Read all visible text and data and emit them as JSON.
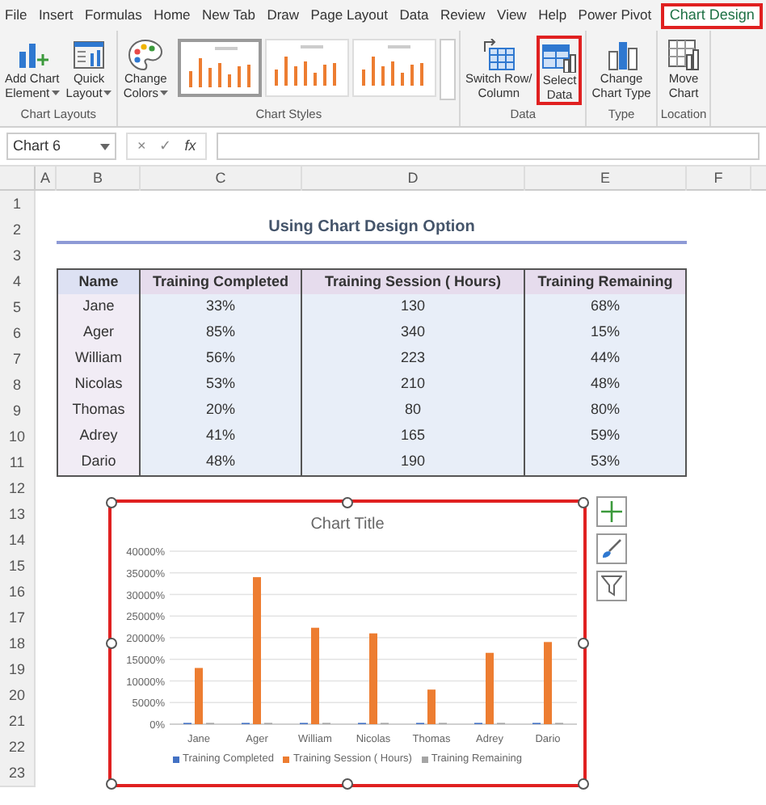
{
  "ribbon": {
    "tabs": [
      {
        "label": "File",
        "selected": false
      },
      {
        "label": "Insert",
        "selected": false
      },
      {
        "label": "Formulas",
        "selected": false
      },
      {
        "label": "Home",
        "selected": false
      },
      {
        "label": "New Tab",
        "selected": false
      },
      {
        "label": "Draw",
        "selected": false
      },
      {
        "label": "Page Layout",
        "selected": false
      },
      {
        "label": "Data",
        "selected": false
      },
      {
        "label": "Review",
        "selected": false
      },
      {
        "label": "View",
        "selected": false
      },
      {
        "label": "Help",
        "selected": false
      },
      {
        "label": "Power Pivot",
        "selected": false
      },
      {
        "label": "Chart Design",
        "selected": true
      }
    ],
    "groups": [
      {
        "label": "Chart Layouts",
        "buttons": [
          {
            "kind": "add-element",
            "lines": [
              "Add Chart",
              "Element"
            ],
            "dropdown": true,
            "highlighted": false
          },
          {
            "kind": "quick-layout",
            "lines": [
              "Quick",
              "Layout"
            ],
            "dropdown": true,
            "highlighted": false
          }
        ]
      },
      {
        "label": "Chart Styles",
        "buttons": [
          {
            "kind": "colors",
            "lines": [
              "Change",
              "Colors"
            ],
            "dropdown": true,
            "highlighted": false
          }
        ],
        "styles": [
          {
            "selected": true
          },
          {
            "selected": false
          },
          {
            "selected": false
          }
        ]
      },
      {
        "label": "Data",
        "buttons": [
          {
            "kind": "switch",
            "lines": [
              "Switch Row/",
              "Column"
            ],
            "dropdown": false,
            "highlighted": false
          },
          {
            "kind": "select-data",
            "lines": [
              "Select",
              "Data"
            ],
            "dropdown": false,
            "highlighted": true
          }
        ]
      },
      {
        "label": "Type",
        "buttons": [
          {
            "kind": "chart-type",
            "lines": [
              "Change",
              "Chart Type"
            ],
            "dropdown": false,
            "highlighted": false
          }
        ]
      },
      {
        "label": "Location",
        "buttons": [
          {
            "kind": "move",
            "lines": [
              "Move",
              "Chart"
            ],
            "dropdown": false,
            "highlighted": false
          }
        ]
      }
    ]
  },
  "formula_bar": {
    "name_box": "Chart 6",
    "buttons": [
      "×",
      "✓",
      "fx"
    ]
  },
  "sheet": {
    "columns": [
      "A",
      "B",
      "C",
      "D",
      "E",
      "F"
    ],
    "rows": [
      "1",
      "2",
      "3",
      "4",
      "5",
      "6",
      "7",
      "8",
      "9",
      "10",
      "11",
      "12",
      "13",
      "14",
      "15",
      "16",
      "17",
      "18",
      "19",
      "20",
      "21",
      "22",
      "23"
    ],
    "title": "Using Chart Design Option",
    "table": {
      "columns": [
        "Name",
        "Training Completed",
        "Training Session ( Hours)",
        "Training Remaining"
      ],
      "rows": [
        [
          "Jane",
          "33%",
          "130",
          "68%"
        ],
        [
          "Ager",
          "85%",
          "340",
          "15%"
        ],
        [
          "William",
          "56%",
          "223",
          "44%"
        ],
        [
          "Nicolas",
          "53%",
          "210",
          "48%"
        ],
        [
          "Thomas",
          "20%",
          "80",
          "80%"
        ],
        [
          "Adrey",
          "41%",
          "165",
          "59%"
        ],
        [
          "Dario",
          "48%",
          "190",
          "53%"
        ]
      ]
    }
  },
  "chart": {
    "chart_data": {
      "type": "bar",
      "title": "Chart Title",
      "categories": [
        "Jane",
        "Ager",
        "William",
        "Nicolas",
        "Thomas",
        "Adrey",
        "Dario"
      ],
      "grid": true,
      "legend": true,
      "series": [
        {
          "name": "Training Completed",
          "color": "#4472c4",
          "values": [
            0,
            0,
            0,
            0,
            0,
            0,
            0
          ]
        },
        {
          "name": "Training Session ( Hours)",
          "color": "#ed7d31",
          "values": [
            13000,
            34000,
            22300,
            21000,
            8000,
            16500,
            19000
          ]
        },
        {
          "name": "Training Remaining",
          "color": "#a5a5a5",
          "values": [
            0,
            0,
            0,
            0,
            0,
            0,
            0
          ]
        }
      ],
      "ylim": [
        0,
        40000
      ],
      "yticks": [
        {
          "value": 0,
          "label": "0%"
        },
        {
          "value": 5000,
          "label": "5000%"
        },
        {
          "value": 10000,
          "label": "10000%"
        },
        {
          "value": 15000,
          "label": "15000%"
        },
        {
          "value": 20000,
          "label": "20000%"
        },
        {
          "value": 25000,
          "label": "25000%"
        },
        {
          "value": 30000,
          "label": "30000%"
        },
        {
          "value": 35000,
          "label": "35000%"
        },
        {
          "value": 40000,
          "label": "40000%"
        }
      ]
    }
  }
}
